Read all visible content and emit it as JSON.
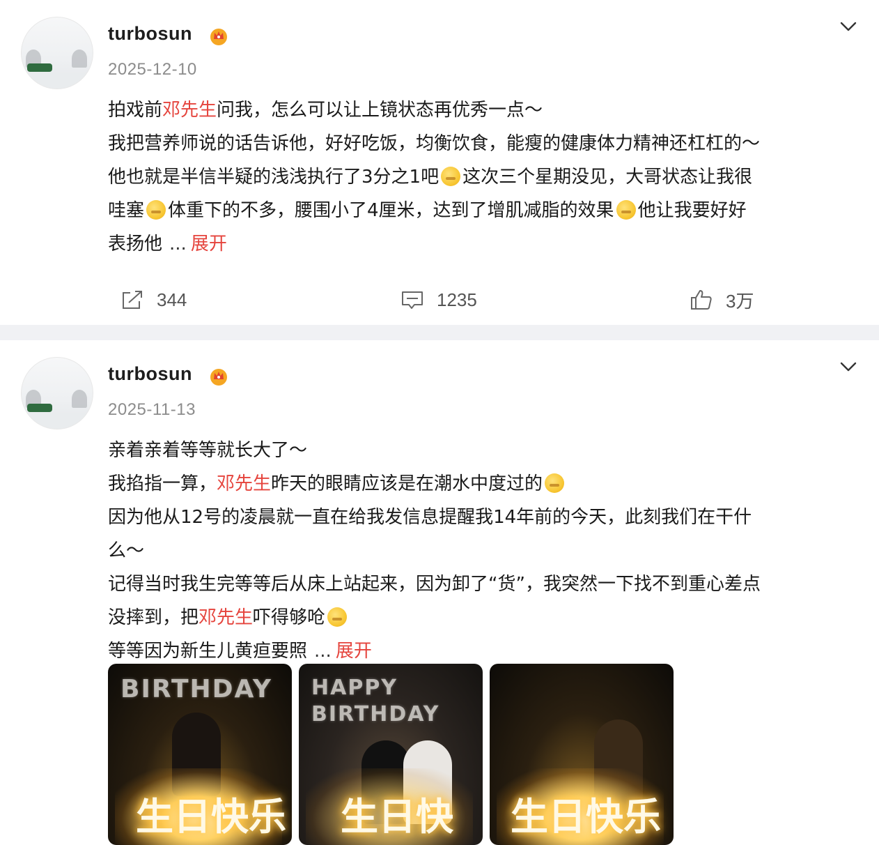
{
  "posts": [
    {
      "username": "turbosun",
      "date": "2025-12-10",
      "lines": [
        [
          {
            "t": "拍戏前"
          },
          {
            "t": "邓先生",
            "hl": true
          },
          {
            "t": "问我，怎么可以让上镜状态再优秀一点～"
          }
        ],
        [
          {
            "t": "我把营养师说的话告诉他，好好吃饭，均衡饮食，能瘦的健康体力精神还杠杠的～"
          }
        ],
        [
          {
            "t": "他也就是半信半疑的浅浅执行了3分之1吧"
          },
          {
            "emoji": "grin"
          },
          {
            "t": "这次三个星期没见，大哥状态让我很"
          }
        ],
        [
          {
            "t": "哇塞"
          },
          {
            "emoji": "smirk"
          },
          {
            "t": "体重下的不多，腰围小了4厘米，达到了增肌减脂的效果"
          },
          {
            "emoji": "smirk"
          },
          {
            "t": "他让我要好好"
          }
        ],
        [
          {
            "t": "表扬他"
          },
          {
            "ellipsis": "..."
          },
          {
            "expand": "展开"
          }
        ]
      ],
      "stats": {
        "share": "344",
        "comment": "1235",
        "like": "3万"
      }
    },
    {
      "username": "turbosun",
      "date": "2025-11-13",
      "lines": [
        [
          {
            "t": "亲着亲着等等就长大了～"
          }
        ],
        [
          {
            "t": "我掐指一算，"
          },
          {
            "t": "邓先生",
            "hl": true
          },
          {
            "t": "昨天的眼睛应该是在潮水中度过的"
          },
          {
            "emoji": "smirk"
          }
        ],
        [
          {
            "t": "因为他从12号的凌晨就一直在给我发信息提醒我14年前的今天，此刻我们在干什"
          }
        ],
        [
          {
            "t": "么～"
          }
        ],
        [
          {
            "t": "记得当时我生完等等后从床上站起来，因为卸了“货”，我突然一下找不到重心差点"
          }
        ],
        [
          {
            "t": "没摔到，把"
          },
          {
            "t": "邓先生",
            "hl": true
          },
          {
            "t": "吓得够呛"
          },
          {
            "emoji": "smirk"
          }
        ],
        [
          {
            "t": "等等因为新生儿黄疸要照"
          },
          {
            "ellipsis": "..."
          },
          {
            "expand": "展开"
          }
        ]
      ],
      "images": [
        {
          "balloon_text": "BIRTHDAY",
          "cake_text": "生日快乐"
        },
        {
          "balloon_text": "HAPPY BIRTHDAY",
          "cake_text": "生日快"
        },
        {
          "balloon_text": "",
          "cake_text": "生日快乐"
        }
      ]
    }
  ],
  "icons": {
    "verified": "crown-badge-icon",
    "menu": "chevron-down-icon",
    "share": "share-icon",
    "comment": "comment-icon",
    "like": "thumbs-up-icon"
  },
  "colors": {
    "highlight": "#e5443d",
    "secondary_text": "#8c8c8c",
    "divider": "#f0f1f4"
  }
}
